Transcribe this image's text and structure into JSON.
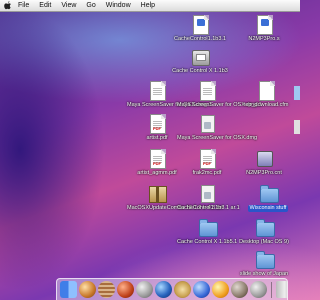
{
  "menubar": {
    "items": [
      "File",
      "Edit",
      "View",
      "Go",
      "Window",
      "Help"
    ]
  },
  "desktop": {
    "icons": [
      {
        "label": "CacheControl1.1b3.1",
        "kind": "doc"
      },
      {
        "label": "N2MP3Pro.s",
        "kind": "doc"
      },
      {
        "label": "Cache Control X 1.1b3",
        "kind": "disk"
      },
      {
        "label": "Maya ScreenSaver for OSX.dmg.1",
        "kind": "doc"
      },
      {
        "label": "Maya ScreenSaver for OSX.dmg.1",
        "kind": "doc"
      },
      {
        "label": "rep_download.cfm",
        "kind": "blank"
      },
      {
        "label": "artist.pdf",
        "kind": "pdf"
      },
      {
        "label": "Maya ScreenSaver for OSX.dmg",
        "kind": "dmg"
      },
      {
        "label": "artist_agmm.pdf",
        "kind": "pdf"
      },
      {
        "label": "frak2mc.pdf",
        "kind": "pdf"
      },
      {
        "label": "N2MP3Pro.cnt",
        "kind": "net"
      },
      {
        "label": "MacOSXUpdateCombo 10.1.2 e 4.3.bn",
        "kind": "pkg"
      },
      {
        "label": "CacheControl1.1b3.1 ar.1",
        "kind": "dmg"
      },
      {
        "label": "Wisconsin stuff",
        "kind": "folder"
      },
      {
        "label": "Cache Control X 1.1b5.1",
        "kind": "folder"
      },
      {
        "label": "Desktop (Mac OS 9)",
        "kind": "folder"
      },
      {
        "label": "slide show of Japan",
        "kind": "folder"
      }
    ]
  },
  "dock": {
    "items": [
      "finder-icon",
      "planet-icon",
      "jupiter-icon",
      "mars-icon",
      "moon-icon",
      "earth-icon",
      "saturn-icon",
      "neptune-icon",
      "sun-icon",
      "mercury-icon",
      "moon-icon",
      "trash-icon"
    ]
  }
}
